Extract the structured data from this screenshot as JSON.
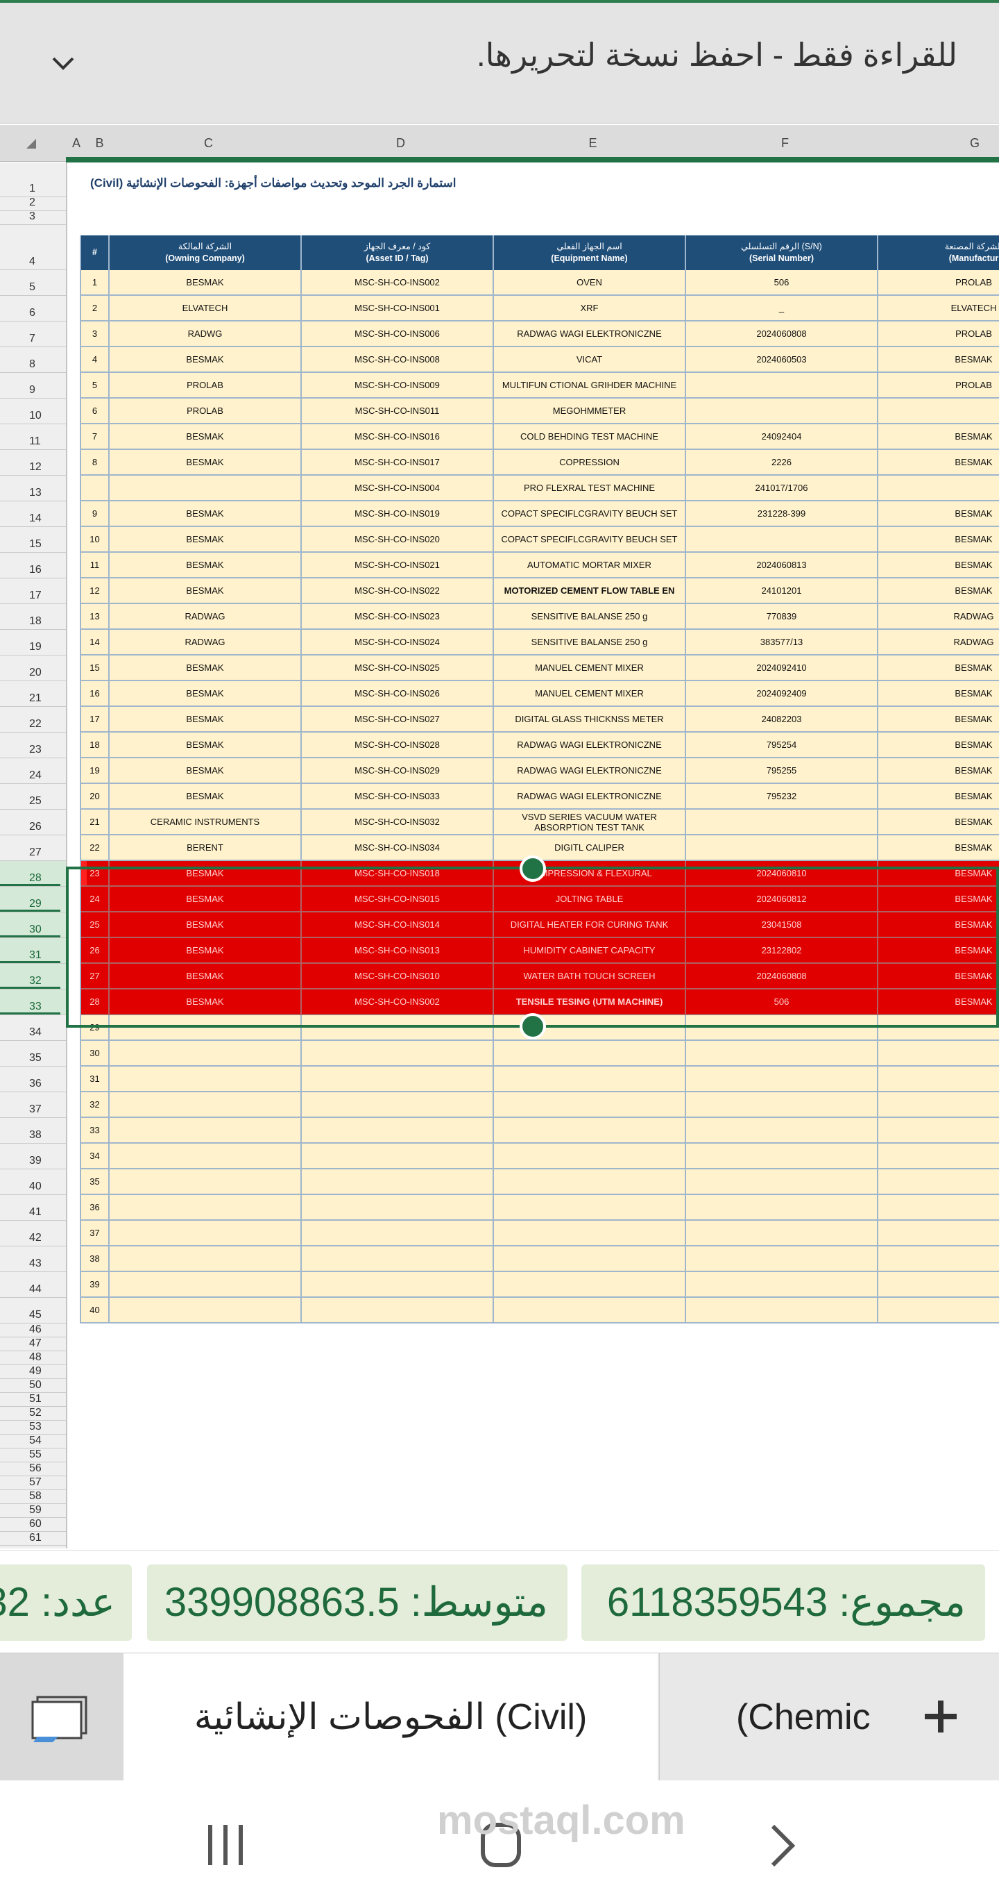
{
  "banner": {
    "message": "للقراءة فقط - احفظ نسخة لتحريرها.",
    "collapse_icon": "chevron-down-icon"
  },
  "columns": [
    "A",
    "B",
    "C",
    "D",
    "E",
    "F",
    "G"
  ],
  "sheet": {
    "title": "استمارة الجرد الموحد وتحديث مواصفات أجهزة: الفحوصات الإنشائية (Civil)",
    "headers": [
      {
        "ar": "",
        "en": "#"
      },
      {
        "ar": "الشركة المالكة",
        "en": "(Owning Company)"
      },
      {
        "ar": "كود / معرف الجهاز",
        "en": "(Asset ID / Tag)"
      },
      {
        "ar": "اسم الجهاز الفعلي",
        "en": "(Equipment Name)"
      },
      {
        "ar": "الرقم التسلسلي (S/N)",
        "en": "(Serial Number)"
      },
      {
        "ar": "الشركة المصنعة",
        "en": "(Manufactur"
      }
    ],
    "rows": [
      {
        "r": "5",
        "n": "1",
        "owner": "BESMAK",
        "asset": "MSC-SH-CO-INS002",
        "name": "OVEN",
        "sn": "506",
        "mfr": "PROLAB"
      },
      {
        "r": "6",
        "n": "2",
        "owner": "ELVATECH",
        "asset": "MSC-SH-CO-INS001",
        "name": "XRF",
        "sn": "_",
        "mfr": "ELVATECH"
      },
      {
        "r": "7",
        "n": "3",
        "owner": "RADWG",
        "asset": "MSC-SH-CO-INS006",
        "name": "RADWAG WAGI ELEKTRONICZNE",
        "sn": "2024060808",
        "mfr": "PROLAB"
      },
      {
        "r": "8",
        "n": "4",
        "owner": "BESMAK",
        "asset": "MSC-SH-CO-INS008",
        "name": "VICAT",
        "sn": "2024060503",
        "mfr": "BESMAK"
      },
      {
        "r": "9",
        "n": "5",
        "owner": "PROLAB",
        "asset": "MSC-SH-CO-INS009",
        "name": "MULTIFUN CTIONAL GRIHDER MACHINE",
        "sn": "",
        "mfr": "PROLAB"
      },
      {
        "r": "10",
        "n": "6",
        "owner": "PROLAB",
        "asset": "MSC-SH-CO-INS011",
        "name": "MEGOHMMETER",
        "sn": "",
        "mfr": ""
      },
      {
        "r": "11",
        "n": "7",
        "owner": "BESMAK",
        "asset": "MSC-SH-CO-INS016",
        "name": "COLD BEHDING TEST MACHINE",
        "sn": "24092404",
        "mfr": "BESMAK"
      },
      {
        "r": "12",
        "n": "8",
        "owner": "BESMAK",
        "asset": "MSC-SH-CO-INS017",
        "name": "COPRESSION",
        "sn": "2226",
        "mfr": "BESMAK"
      },
      {
        "r": "13",
        "n": "",
        "owner": "",
        "asset": "MSC-SH-CO-INS004",
        "name": "PRO FLEXRAL TEST MACHINE",
        "sn": "241017/1706",
        "mfr": ""
      },
      {
        "r": "14",
        "n": "9",
        "owner": "BESMAK",
        "asset": "MSC-SH-CO-INS019",
        "name": "COPACT SPECIFLCGRAVITY BEUCH SET",
        "sn": "231228-399",
        "mfr": "BESMAK"
      },
      {
        "r": "15",
        "n": "10",
        "owner": "BESMAK",
        "asset": "MSC-SH-CO-INS020",
        "name": "COPACT SPECIFLCGRAVITY BEUCH SET",
        "sn": "",
        "mfr": "BESMAK"
      },
      {
        "r": "16",
        "n": "11",
        "owner": "BESMAK",
        "asset": "MSC-SH-CO-INS021",
        "name": "AUTOMATIC MORTAR MIXER",
        "sn": "2024060813",
        "mfr": "BESMAK"
      },
      {
        "r": "17",
        "n": "12",
        "owner": "BESMAK",
        "asset": "MSC-SH-CO-INS022",
        "name": "MOTORIZED CEMENT FLOW TABLE EN",
        "sn": "24101201",
        "mfr": "BESMAK",
        "bold": true
      },
      {
        "r": "18",
        "n": "13",
        "owner": "RADWAG",
        "asset": "MSC-SH-CO-INS023",
        "name": "SENSITIVE BALANSE 250 g",
        "sn": "770839",
        "mfr": "RADWAG"
      },
      {
        "r": "19",
        "n": "14",
        "owner": "RADWAG",
        "asset": "MSC-SH-CO-INS024",
        "name": "SENSITIVE BALANSE 250 g",
        "sn": "383577/13",
        "mfr": "RADWAG"
      },
      {
        "r": "20",
        "n": "15",
        "owner": "BESMAK",
        "asset": "MSC-SH-CO-INS025",
        "name": "MANUEL CEMENT MIXER",
        "sn": "2024092410",
        "mfr": "BESMAK"
      },
      {
        "r": "21",
        "n": "16",
        "owner": "BESMAK",
        "asset": "MSC-SH-CO-INS026",
        "name": "MANUEL CEMENT MIXER",
        "sn": "2024092409",
        "mfr": "BESMAK"
      },
      {
        "r": "22",
        "n": "17",
        "owner": "BESMAK",
        "asset": "MSC-SH-CO-INS027",
        "name": "DIGITAL GLASS THICKNSS METER",
        "sn": "24082203",
        "mfr": "BESMAK"
      },
      {
        "r": "23",
        "n": "18",
        "owner": "BESMAK",
        "asset": "MSC-SH-CO-INS028",
        "name": "RADWAG WAGI ELEKTRONICZNE",
        "sn": "795254",
        "mfr": "BESMAK"
      },
      {
        "r": "24",
        "n": "19",
        "owner": "BESMAK",
        "asset": "MSC-SH-CO-INS029",
        "name": "RADWAG WAGI ELEKTRONICZNE",
        "sn": "795255",
        "mfr": "BESMAK"
      },
      {
        "r": "25",
        "n": "20",
        "owner": "BESMAK",
        "asset": "MSC-SH-CO-INS033",
        "name": "RADWAG WAGI ELEKTRONICZNE",
        "sn": "795232",
        "mfr": "BESMAK"
      },
      {
        "r": "26",
        "n": "21",
        "owner": "CERAMIC INSTRUMENTS",
        "asset": "MSC-SH-CO-INS032",
        "name": "VSVD SERIES VACUUM WATER ABSORPTION TEST TANK",
        "sn": "",
        "mfr": "BESMAK"
      },
      {
        "r": "27",
        "n": "22",
        "owner": "BERENT",
        "asset": "MSC-SH-CO-INS034",
        "name": "DIGITL CALIPER",
        "sn": "",
        "mfr": "BESMAK"
      },
      {
        "r": "28",
        "n": "23",
        "owner": "BESMAK",
        "asset": "MSC-SH-CO-INS018",
        "name": "COMPRESSION & FLEXURAL",
        "sn": "2024060810",
        "mfr": "BESMAK",
        "red": true
      },
      {
        "r": "29",
        "n": "24",
        "owner": "BESMAK",
        "asset": "MSC-SH-CO-INS015",
        "name": "JOLTING TABLE",
        "sn": "2024060812",
        "mfr": "BESMAK",
        "red": true
      },
      {
        "r": "30",
        "n": "25",
        "owner": "BESMAK",
        "asset": "MSC-SH-CO-INS014",
        "name": "DIGITAL HEATER FOR CURING TANK",
        "sn": "23041508",
        "mfr": "BESMAK",
        "red": true
      },
      {
        "r": "31",
        "n": "26",
        "owner": "BESMAK",
        "asset": "MSC-SH-CO-INS013",
        "name": "HUMIDITY CABINET CAPACITY",
        "sn": "23122802",
        "mfr": "BESMAK",
        "red": true
      },
      {
        "r": "32",
        "n": "27",
        "owner": "BESMAK",
        "asset": "MSC-SH-CO-INS010",
        "name": "WATER BATH TOUCH SCREEH",
        "sn": "2024060808",
        "mfr": "BESMAK",
        "red": true
      },
      {
        "r": "33",
        "n": "28",
        "owner": "BESMAK",
        "asset": "MSC-SH-CO-INS002",
        "name": "TENSILE TESING (UTM MACHINE)",
        "sn": "506",
        "mfr": "BESMAK",
        "red": true,
        "bold": true
      },
      {
        "r": "34",
        "n": "29"
      },
      {
        "r": "35",
        "n": "30"
      },
      {
        "r": "36",
        "n": "31"
      },
      {
        "r": "37",
        "n": "32"
      },
      {
        "r": "38",
        "n": "33"
      },
      {
        "r": "39",
        "n": "34"
      },
      {
        "r": "40",
        "n": "35"
      },
      {
        "r": "41",
        "n": "36"
      },
      {
        "r": "42",
        "n": "37"
      },
      {
        "r": "43",
        "n": "38"
      },
      {
        "r": "44",
        "n": "39"
      },
      {
        "r": "45",
        "n": "40"
      }
    ],
    "extra_row_numbers": [
      "46",
      "47",
      "48",
      "49",
      "50",
      "51",
      "52",
      "53",
      "54",
      "55",
      "56",
      "57",
      "58",
      "59",
      "60",
      "61"
    ]
  },
  "status": {
    "count": "عدد: 32",
    "average": "متوسط: 339908863.5",
    "sum": "مجموع: 6118359543"
  },
  "tabs": {
    "active": "الفحوصات الإنشائية (Civil)",
    "other": "(Chemic",
    "sheets_icon": "sheets-list-icon",
    "add_icon": "plus-icon"
  },
  "navbar": {
    "recent_icon": "recent-apps-icon",
    "home_icon": "home-icon",
    "back_icon": "back-icon",
    "watermark": "mostaql.com"
  },
  "colors": {
    "accent": "#217346",
    "header_fill": "#1f4e79",
    "cell_fill": "#fff2cc",
    "highlight": "#e00000"
  }
}
